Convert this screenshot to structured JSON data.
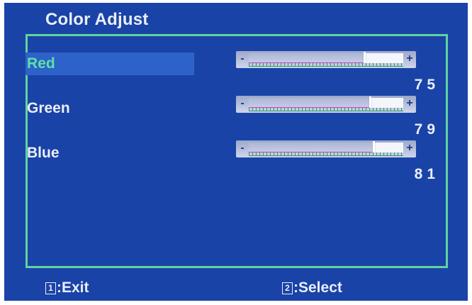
{
  "menu": {
    "title": "Color Adjust"
  },
  "colors": {
    "background": "#1a43a7",
    "border": "#5fd3a0",
    "selected_text": "#5fe0a8",
    "selection_bar": "#2d62c9"
  },
  "settings": [
    {
      "label": "Red",
      "value": "75",
      "level": 75,
      "selected": true
    },
    {
      "label": "Green",
      "value": "79",
      "level": 79,
      "selected": false
    },
    {
      "label": "Blue",
      "value": "81",
      "level": 81,
      "selected": false
    }
  ],
  "slider": {
    "minus_symbol": "-",
    "plus_symbol": "+"
  },
  "footer": {
    "exit_key": "1",
    "exit_label": ":Exit",
    "select_key": "2",
    "select_label": ":Select"
  }
}
